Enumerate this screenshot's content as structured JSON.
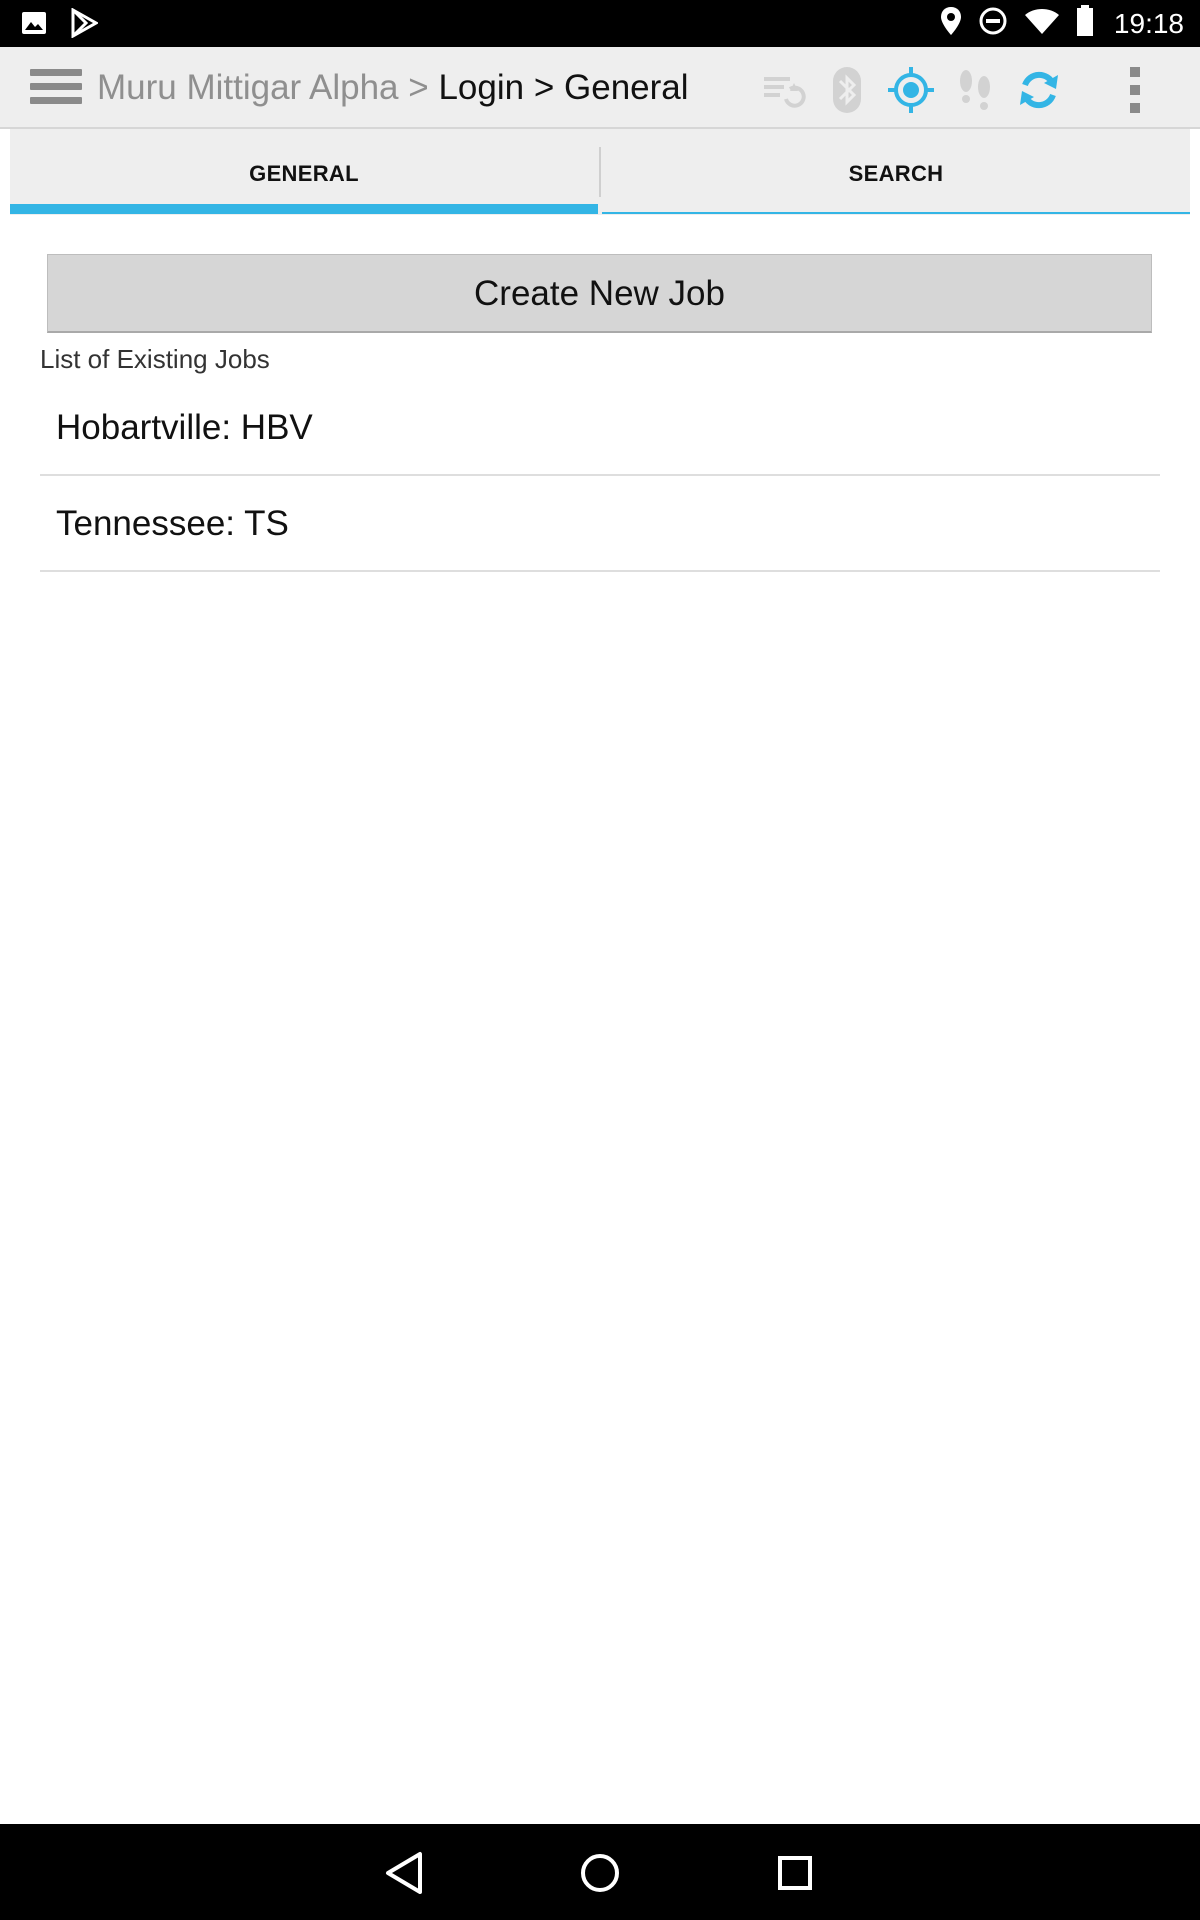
{
  "status_bar": {
    "time": "19:18",
    "left_icons": [
      "image-icon",
      "play-store-icon"
    ],
    "right_icons": [
      "location-icon",
      "do-not-disturb-icon",
      "wifi-icon",
      "battery-icon"
    ]
  },
  "app_bar": {
    "breadcrumb": {
      "app_name": "Muru Mittigar Alpha",
      "separator": ">",
      "login": "Login",
      "current": "General"
    },
    "toolbar_icons": [
      "sync-list-icon",
      "bluetooth-icon",
      "gps-icon",
      "footsteps-icon",
      "refresh-icon",
      "overflow-menu-icon"
    ]
  },
  "tabs": [
    {
      "label": "GENERAL",
      "selected": true
    },
    {
      "label": "SEARCH",
      "selected": false
    }
  ],
  "main": {
    "create_button_label": "Create New Job",
    "list_label": "List of Existing Jobs",
    "jobs": [
      {
        "label": "Hobartville: HBV"
      },
      {
        "label": "Tennessee: TS"
      }
    ]
  },
  "nav_bar": {
    "buttons": [
      "back-icon",
      "home-icon",
      "recents-icon"
    ]
  },
  "colors": {
    "accent": "#33b5e5",
    "app_bar_bg": "#eeeeee",
    "button_bg": "#d6d6d6"
  }
}
